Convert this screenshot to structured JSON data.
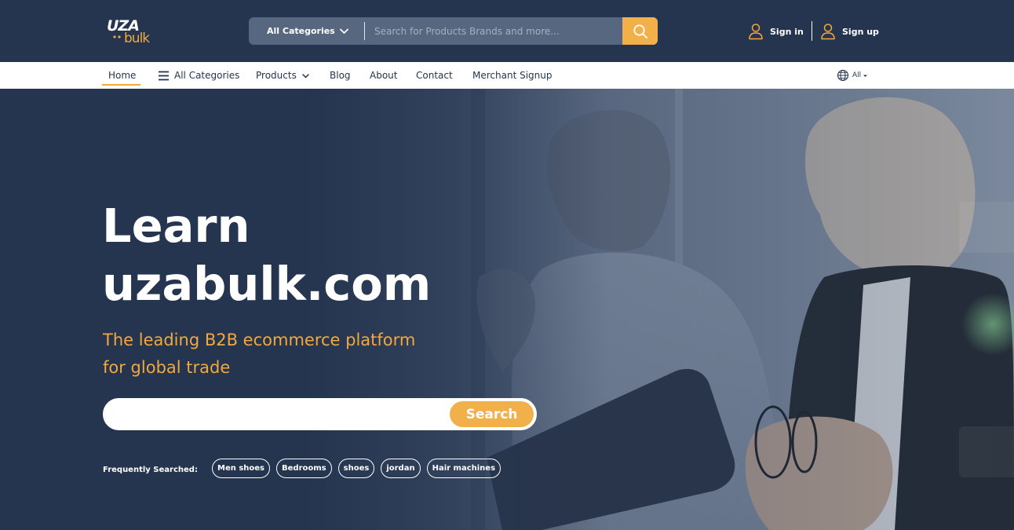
{
  "header": {
    "logo_text_top": "UZA",
    "logo_text_bottom": "bulk",
    "category_select": "All Categories",
    "search_placeholder": "Search for Products Brands and more...",
    "sign_in": "Sign in",
    "sign_up": "Sign up"
  },
  "nav": {
    "items": [
      "Home",
      "All Categories",
      "Products",
      "Blog",
      "About",
      "Contact",
      "Merchant Signup"
    ],
    "language": "All"
  },
  "hero": {
    "title_line1": "Learn",
    "title_line2": "uzabulk.com",
    "subtitle_line1": "The leading B2B ecommerce platform",
    "subtitle_line2": "for global trade",
    "search_value": "",
    "search_button": "Search",
    "frequently_label": "Frequently Searched:",
    "chips": [
      "Men shoes",
      "Bedrooms",
      "shoes",
      "jordan",
      "Hair machines"
    ]
  },
  "colors": {
    "navy": "#253550",
    "accent": "#f2a83b",
    "white": "#ffffff"
  },
  "icons": {
    "search": "search-icon",
    "chevron": "chevron-down-icon",
    "user": "user-icon",
    "menu": "hamburger-icon",
    "globe": "globe-icon"
  }
}
